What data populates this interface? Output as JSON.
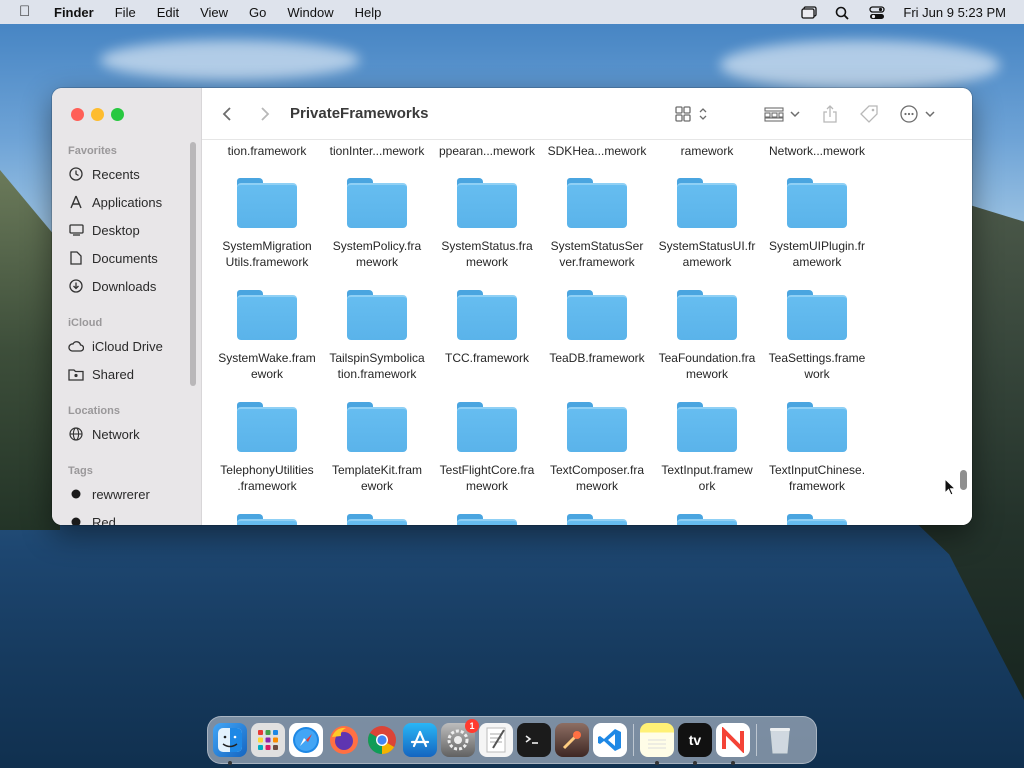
{
  "menubar": {
    "app_name": "Finder",
    "menus": [
      "File",
      "Edit",
      "View",
      "Go",
      "Window",
      "Help"
    ],
    "clock": "Fri Jun 9  5:23 PM"
  },
  "window": {
    "title": "PrivateFrameworks"
  },
  "sidebar": {
    "favorites_header": "Favorites",
    "favorites": [
      {
        "label": "Recents",
        "icon": "clock-icon"
      },
      {
        "label": "Applications",
        "icon": "applications-icon"
      },
      {
        "label": "Desktop",
        "icon": "desktop-icon"
      },
      {
        "label": "Documents",
        "icon": "document-icon"
      },
      {
        "label": "Downloads",
        "icon": "download-icon"
      }
    ],
    "icloud_header": "iCloud",
    "icloud": [
      {
        "label": "iCloud Drive",
        "icon": "cloud-icon"
      },
      {
        "label": "Shared",
        "icon": "shared-folder-icon"
      }
    ],
    "locations_header": "Locations",
    "locations": [
      {
        "label": "Network",
        "icon": "globe-icon"
      }
    ],
    "tags_header": "Tags",
    "tags": [
      {
        "label": "rewwrerer",
        "color": "#1a1a1a"
      },
      {
        "label": "Red",
        "color": "#1a1a1a"
      }
    ]
  },
  "files": {
    "row0": [
      "tion.framework",
      "tionInter...mework",
      "ppearan...mework",
      "SDKHea...mework",
      "ramework",
      "Network...mework"
    ],
    "row1": [
      {
        "line1": "SystemMigration",
        "line2": "Utils.framework"
      },
      {
        "line1": "SystemPolicy.fra",
        "line2": "mework"
      },
      {
        "line1": "SystemStatus.fra",
        "line2": "mework"
      },
      {
        "line1": "SystemStatusSer",
        "line2": "ver.framework"
      },
      {
        "line1": "SystemStatusUI.fr",
        "line2": "amework"
      },
      {
        "line1": "SystemUIPlugin.fr",
        "line2": "amework"
      }
    ],
    "row2": [
      {
        "line1": "SystemWake.fram",
        "line2": "ework"
      },
      {
        "line1": "TailspinSymbolica",
        "line2": "tion.framework"
      },
      {
        "line1": "TCC.framework",
        "line2": ""
      },
      {
        "line1": "TeaDB.framework",
        "line2": ""
      },
      {
        "line1": "TeaFoundation.fra",
        "line2": "mework"
      },
      {
        "line1": "TeaSettings.frame",
        "line2": "work"
      }
    ],
    "row3": [
      {
        "line1": "TelephonyUtilities",
        "line2": ".framework"
      },
      {
        "line1": "TemplateKit.fram",
        "line2": "ework"
      },
      {
        "line1": "TestFlightCore.fra",
        "line2": "mework"
      },
      {
        "line1": "TextComposer.fra",
        "line2": "mework"
      },
      {
        "line1": "TextInput.framew",
        "line2": "ork"
      },
      {
        "line1": "TextInputChinese.",
        "line2": "framework"
      }
    ]
  },
  "dock": {
    "apps": [
      {
        "name": "Finder",
        "icon": "finder-icon",
        "color": "#1e88e5"
      },
      {
        "name": "Launchpad",
        "icon": "launchpad-icon",
        "color": "#9e9e9e"
      },
      {
        "name": "Safari",
        "icon": "safari-icon",
        "color": "#1976d2"
      },
      {
        "name": "Firefox",
        "icon": "firefox-icon",
        "color": "#e65100"
      },
      {
        "name": "Chrome",
        "icon": "chrome-icon",
        "color": "#f5f5f5"
      },
      {
        "name": "App Store",
        "icon": "app-store-icon",
        "color": "#1e88e5"
      },
      {
        "name": "System Preferences",
        "icon": "settings-icon",
        "color": "#757575",
        "badge": "1"
      },
      {
        "name": "TextEdit",
        "icon": "textedit-icon",
        "color": "#eeeeee"
      },
      {
        "name": "Terminal",
        "icon": "terminal-icon",
        "color": "#212121"
      },
      {
        "name": "Instruments",
        "icon": "instruments-icon",
        "color": "#5d4037"
      },
      {
        "name": "VS Code",
        "icon": "vscode-icon",
        "color": "#1565c0"
      },
      {
        "name": "Notes",
        "icon": "notes-icon",
        "color": "#fff59d"
      },
      {
        "name": "TV",
        "icon": "apple-tv-icon",
        "color": "#111111",
        "label": "tv"
      },
      {
        "name": "News",
        "icon": "news-icon",
        "color": "#ffffff"
      },
      {
        "name": "Trash",
        "icon": "trash-icon",
        "color": "#cfd8dc"
      }
    ]
  }
}
